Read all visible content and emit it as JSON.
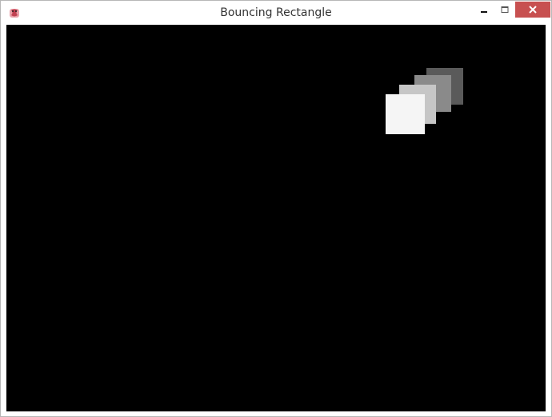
{
  "window": {
    "title": "Bouncing Rectangle",
    "icon": "pygame-snake-icon",
    "controls": {
      "minimize_icon": "minimize-icon",
      "maximize_icon": "maximize-icon",
      "close_icon": "close-icon",
      "close_color": "#c75050"
    }
  },
  "canvas": {
    "background": "#000000",
    "rectangles": [
      {
        "color": "#5a5a5a"
      },
      {
        "color": "#8a8a8a"
      },
      {
        "color": "#c6c6c6"
      },
      {
        "color": "#f5f5f5"
      }
    ]
  }
}
